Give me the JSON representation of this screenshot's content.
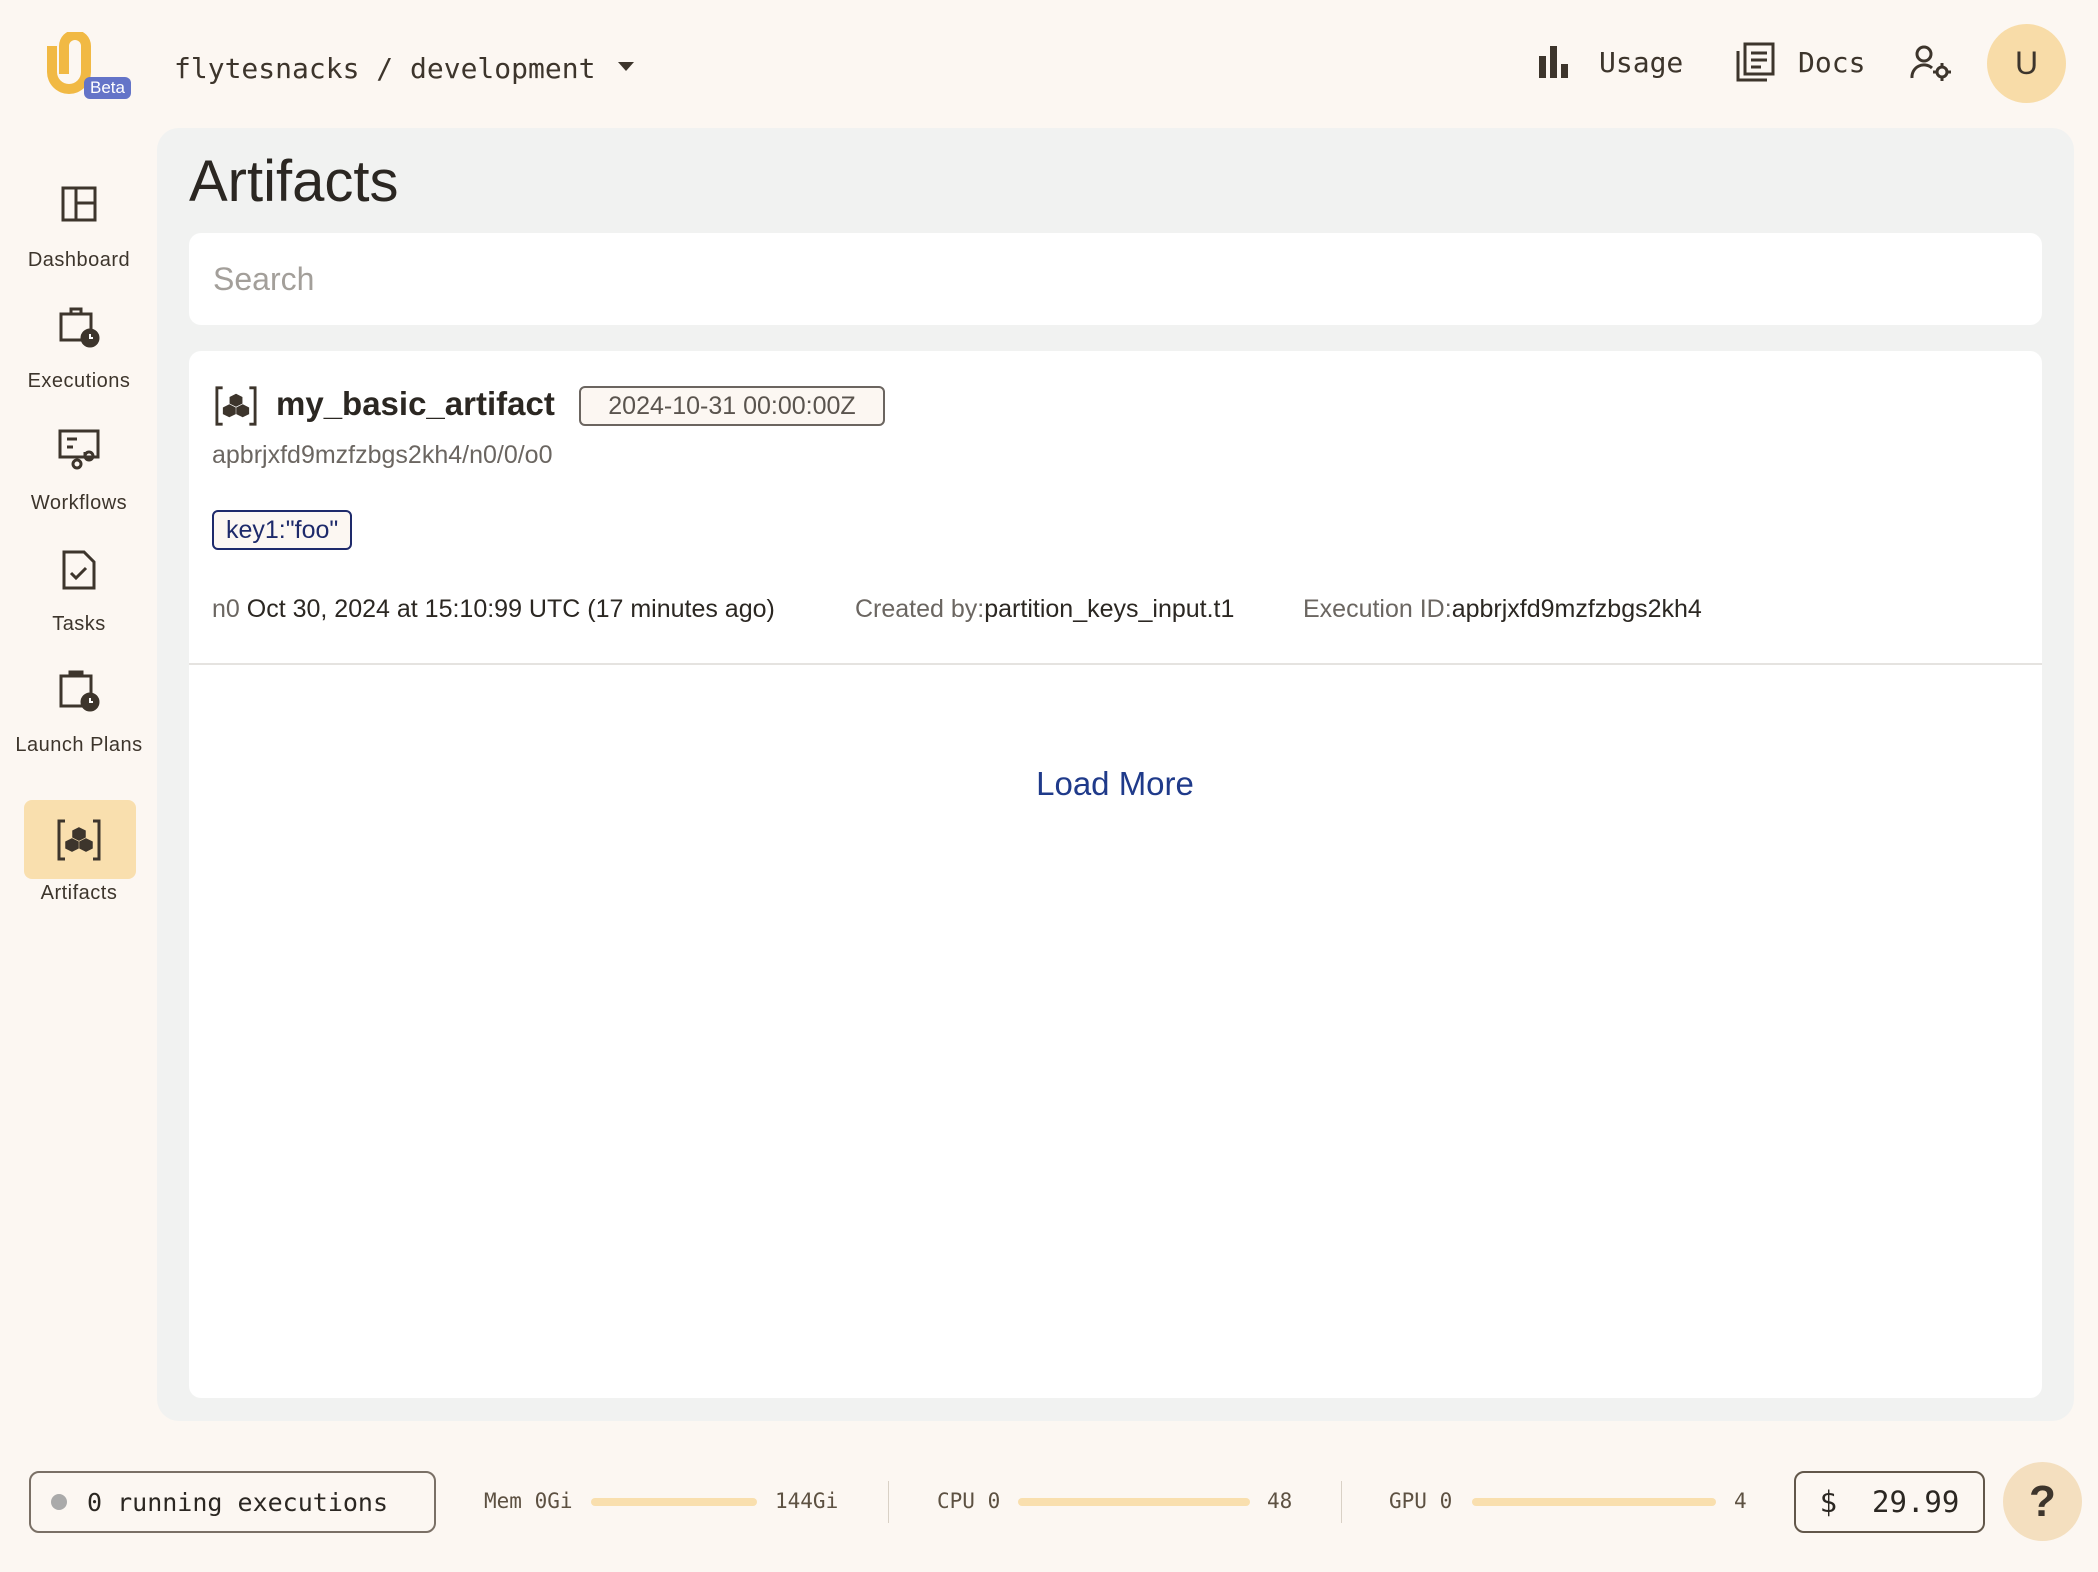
{
  "header": {
    "beta_badge": "Beta",
    "breadcrumb": "flytesnacks / development",
    "usage_label": "Usage",
    "docs_label": "Docs",
    "avatar_initial": "U"
  },
  "sidebar": {
    "items": [
      {
        "label": "Dashboard",
        "icon": "dashboard-icon"
      },
      {
        "label": "Executions",
        "icon": "executions-icon"
      },
      {
        "label": "Workflows",
        "icon": "workflows-icon"
      },
      {
        "label": "Tasks",
        "icon": "tasks-icon"
      },
      {
        "label": "Launch Plans",
        "icon": "launch-plans-icon"
      },
      {
        "label": "Artifacts",
        "icon": "artifacts-icon",
        "active": true
      }
    ]
  },
  "main": {
    "title": "Artifacts",
    "search_placeholder": "Search",
    "artifacts": [
      {
        "name": "my_basic_artifact",
        "date_badge": "2024-10-31 00:00:00Z",
        "uri": "apbrjxfd9mzfzbgs2kh4/n0/0/o0",
        "partition_tag": "key1:\"foo\"",
        "node": "n0",
        "created_at": "Oct 30, 2024 at 15:10:99 UTC (17 minutes ago)",
        "created_by_label": "Created by:",
        "created_by": "partition_keys_input.t1",
        "execution_id_label": "Execution ID:",
        "execution_id": "apbrjxfd9mzfzbgs2kh4"
      }
    ],
    "load_more": "Load More"
  },
  "footer": {
    "running": "0 running executions",
    "mem_label": "Mem 0Gi",
    "mem_max": "144Gi",
    "mem_used_fraction": 0,
    "cpu_label": "CPU 0",
    "cpu_max": "48",
    "cpu_used_fraction": 0,
    "gpu_label": "GPU 0",
    "gpu_max": "4",
    "gpu_used_fraction": 0,
    "cost": "$  29.99",
    "help": "?"
  },
  "colors": {
    "accent": "#f9dfae",
    "link": "#1f3a8a",
    "tag_border": "#1e2a6b",
    "beta": "#6474c8"
  }
}
